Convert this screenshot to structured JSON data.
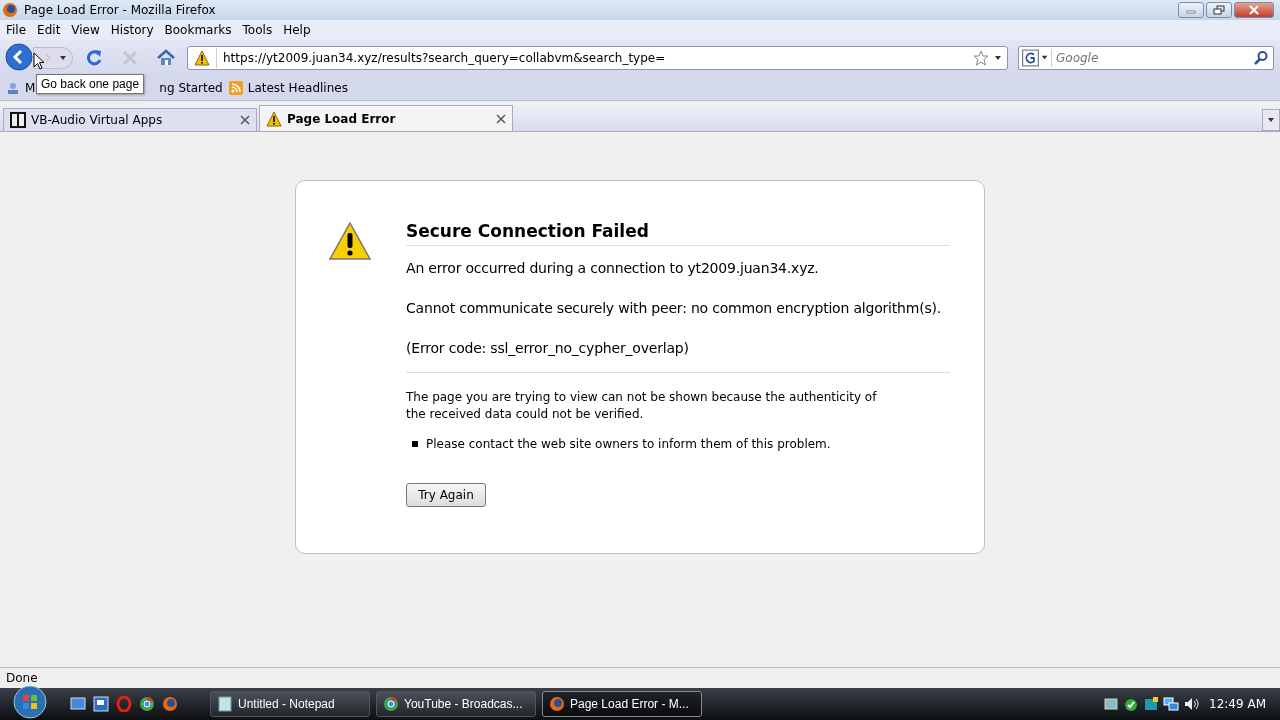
{
  "window": {
    "title": "Page Load Error - Mozilla Firefox"
  },
  "menu": [
    "File",
    "Edit",
    "View",
    "History",
    "Bookmarks",
    "Tools",
    "Help"
  ],
  "address": {
    "value": "https://yt2009.juan34.xyz/results?search_query=collabvm&search_type="
  },
  "search": {
    "placeholder": "Google"
  },
  "tooltip": "Go back one page",
  "bookmarks": [
    {
      "label": "M",
      "kind": "visited"
    },
    {
      "label": "ng Started",
      "kind": "plain"
    },
    {
      "label": "Latest Headlines",
      "kind": "feed"
    }
  ],
  "tabs": [
    {
      "label": "VB-Audio Virtual Apps",
      "selected": false,
      "kind": "vb"
    },
    {
      "label": "Page Load Error",
      "selected": true,
      "kind": "warning"
    }
  ],
  "error": {
    "title": "Secure Connection Failed",
    "lines": [
      "An error occurred during a connection to yt2009.juan34.xyz.",
      "Cannot communicate securely with peer: no common encryption algorithm(s).",
      "(Error code: ssl_error_no_cypher_overlap)"
    ],
    "description": "The page you are trying to view can not be shown because the authenticity of the received data could not be verified.",
    "bullets": [
      "Please contact the web site owners to inform them of this problem."
    ],
    "button": "Try Again"
  },
  "status_bar": "Done",
  "taskbar": {
    "windows": [
      {
        "label": "Untitled - Notepad",
        "selected": false,
        "kind": "notepad"
      },
      {
        "label": "YouTube - Broadcas...",
        "selected": false,
        "kind": "chrome"
      },
      {
        "label": "Page Load Error - M...",
        "selected": true,
        "kind": "firefox"
      }
    ],
    "clock": "12:49 AM"
  }
}
